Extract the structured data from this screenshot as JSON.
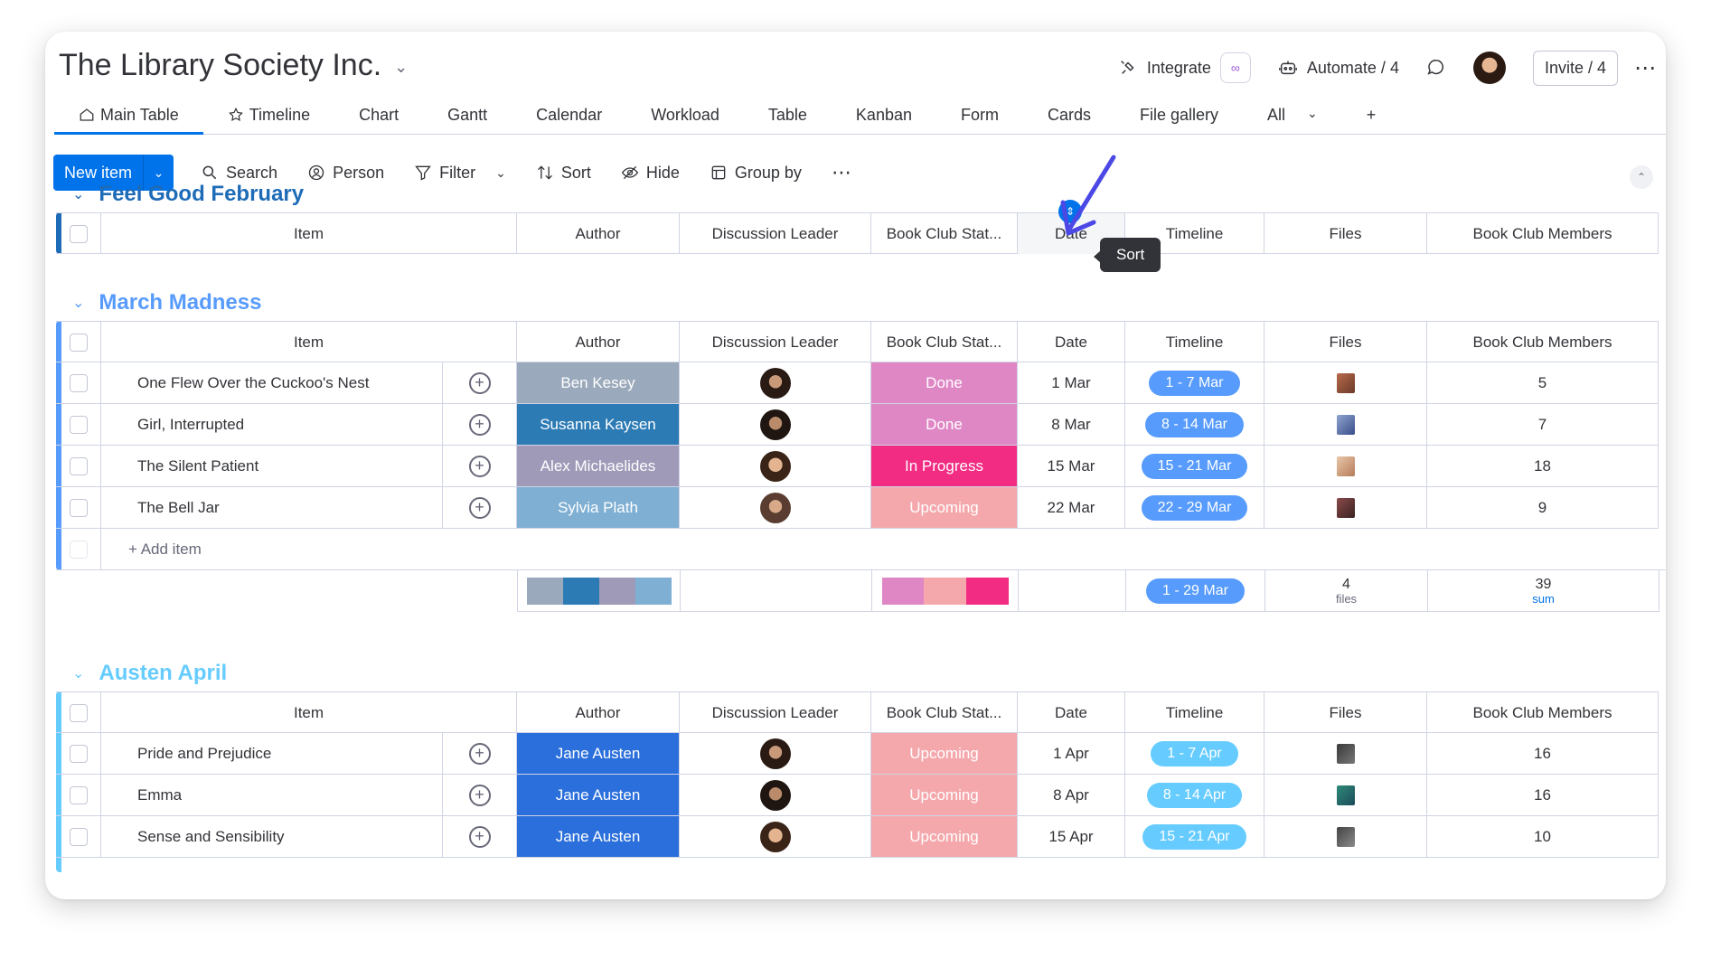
{
  "board": {
    "title": "The Library Society Inc."
  },
  "header": {
    "integrate_label": "Integrate",
    "automate_label": "Automate / 4",
    "invite_label": "Invite / 4"
  },
  "tabs": [
    "Main Table",
    "Timeline",
    "Chart",
    "Gantt",
    "Calendar",
    "Workload",
    "Table",
    "Kanban",
    "Form",
    "Cards",
    "File gallery",
    "All",
    "+"
  ],
  "toolbar": {
    "new_item": "New item",
    "search": "Search",
    "person": "Person",
    "filter": "Filter",
    "sort": "Sort",
    "hide": "Hide",
    "group_by": "Group by"
  },
  "columns": {
    "item": "Item",
    "author": "Author",
    "lead": "Discussion Leader",
    "status": "Book Club Stat...",
    "date": "Date",
    "timeline": "Timeline",
    "files": "Files",
    "members": "Book Club Members"
  },
  "tooltip": "Sort",
  "colors": {
    "feb": "#1e6bb8",
    "march": "#579bfc",
    "april": "#66ccff",
    "done": "#df87c5",
    "in_progress": "#f22b83",
    "upcoming": "#f4a8ac",
    "tl_march": "#579bfc",
    "tl_april": "#66ccff"
  },
  "groups": {
    "feb": {
      "title": "Feel Good February"
    },
    "march": {
      "title": "March Madness",
      "add_item": "+ Add item",
      "rows": [
        {
          "item": "One Flew Over the Cuckoo's Nest",
          "author": "Ben Kesey",
          "author_color": "#9aa9bb",
          "status": "Done",
          "status_color": "#df87c5",
          "date": "1 Mar",
          "timeline": "1 - 7 Mar",
          "members": "5"
        },
        {
          "item": "Girl, Interrupted",
          "author": "Susanna Kaysen",
          "author_color": "#2d7bb5",
          "status": "Done",
          "status_color": "#df87c5",
          "date": "8 Mar",
          "timeline": "8 - 14 Mar",
          "members": "7"
        },
        {
          "item": "The Silent Patient",
          "author": "Alex Michaelides",
          "author_color": "#9e9ab8",
          "status": "In Progress",
          "status_color": "#f22b83",
          "date": "15 Mar",
          "timeline": "15 - 21 Mar",
          "members": "18"
        },
        {
          "item": "The Bell Jar",
          "author": "Sylvia Plath",
          "author_color": "#7fafd3",
          "status": "Upcoming",
          "status_color": "#f4a8ac",
          "date": "22 Mar",
          "timeline": "22 - 29 Mar",
          "members": "9"
        }
      ],
      "summary": {
        "timeline": "1 - 29 Mar",
        "files_count": "4",
        "files_label": "files",
        "members_sum": "39",
        "members_label": "sum"
      }
    },
    "april": {
      "title": "Austen April",
      "rows": [
        {
          "item": "Pride and Prejudice",
          "author": "Jane Austen",
          "author_color": "#2a6fdb",
          "status": "Upcoming",
          "status_color": "#f4a8ac",
          "date": "1 Apr",
          "timeline": "1 - 7 Apr",
          "members": "16"
        },
        {
          "item": "Emma",
          "author": "Jane Austen",
          "author_color": "#2a6fdb",
          "status": "Upcoming",
          "status_color": "#f4a8ac",
          "date": "8 Apr",
          "timeline": "8 - 14 Apr",
          "members": "16"
        },
        {
          "item": "Sense and Sensibility",
          "author": "Jane Austen",
          "author_color": "#2a6fdb",
          "status": "Upcoming",
          "status_color": "#f4a8ac",
          "date": "15 Apr",
          "timeline": "15 - 21 Apr",
          "members": "10"
        }
      ]
    }
  }
}
